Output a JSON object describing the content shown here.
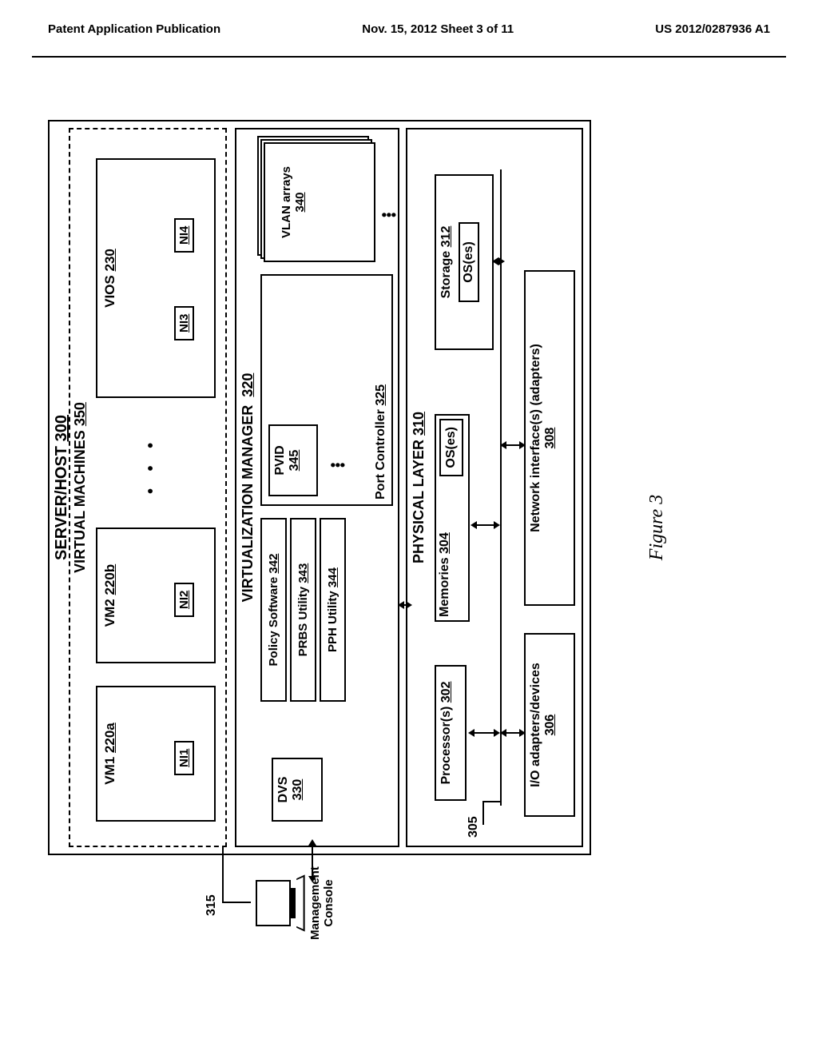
{
  "header": {
    "left": "Patent Application Publication",
    "center": "Nov. 15, 2012  Sheet 3 of 11",
    "right": "US 2012/0287936 A1"
  },
  "server_host": {
    "title": "SERVER/HOST",
    "ref": "300"
  },
  "virtual_machines": {
    "title": "VIRTUAL MACHINES",
    "ref": "350",
    "items": [
      {
        "label": "VM1",
        "ref": "220a",
        "nis": [
          "NI1"
        ]
      },
      {
        "label": "VM2",
        "ref": "220b",
        "nis": [
          "NI2"
        ]
      },
      {
        "label": "VIOS",
        "ref": "230",
        "nis": [
          "NI3",
          "NI4"
        ]
      }
    ],
    "ellipsis": "• • •"
  },
  "vmgr": {
    "title": "VIRTUALIZATION MANAGER",
    "ref": "320",
    "dvs": {
      "label": "DVS",
      "ref": "330"
    },
    "policy": {
      "label": "Policy Software",
      "ref": "342"
    },
    "prbs": {
      "label": "PRBS Utility",
      "ref": "343"
    },
    "pph": {
      "label": "PPH Utility",
      "ref": "344"
    },
    "port_ctrl": {
      "label": "Port Controller",
      "ref": "325"
    },
    "pvid": {
      "label": "PVID",
      "ref": "345"
    },
    "vlan_arrays": {
      "label": "VLAN arrays",
      "ref": "340"
    }
  },
  "phys": {
    "title": "PHYSICAL LAYER",
    "ref": "310",
    "bus_ref": "305",
    "processors": {
      "label": "Processor(s)",
      "ref": "302"
    },
    "memories": {
      "label": "Memories",
      "ref": "304",
      "inner": "OS(es)"
    },
    "storage": {
      "label": "Storage",
      "ref": "312",
      "inner": "OS(es)"
    },
    "io": {
      "label": "I/O adapters/devices",
      "ref": "306"
    },
    "nics": {
      "label": "Network interface(s) (adapters)",
      "ref": "308"
    }
  },
  "mconsole": {
    "label": "Management Console",
    "ref": "315"
  },
  "figure": {
    "label": "Figure 3"
  }
}
